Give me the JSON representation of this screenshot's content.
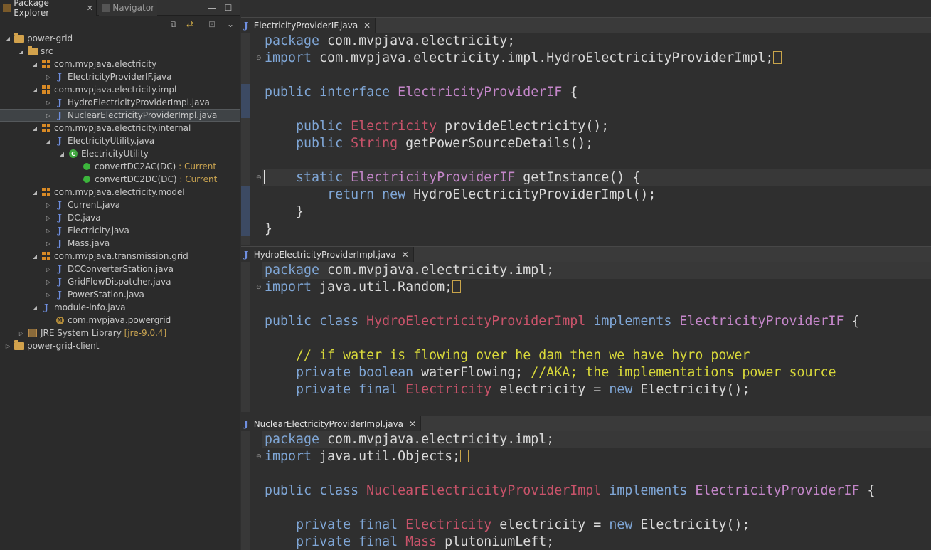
{
  "left_panel": {
    "tabs": [
      {
        "label": "Package Explorer",
        "active": true
      },
      {
        "label": "Navigator",
        "active": false
      }
    ],
    "tree": [
      {
        "label": "power-grid",
        "icon": "project-folder-icon",
        "level": 0,
        "expanded": true
      },
      {
        "label": "src",
        "icon": "source-folder-icon",
        "level": 1,
        "expanded": true
      },
      {
        "label": "com.mvpjava.electricity",
        "icon": "package-icon",
        "level": 2,
        "expanded": true
      },
      {
        "label": "ElectricityProviderIF.java",
        "icon": "java-interface-file-icon",
        "level": 3,
        "expanded": false
      },
      {
        "label": "com.mvpjava.electricity.impl",
        "icon": "package-icon",
        "level": 2,
        "expanded": true
      },
      {
        "label": "HydroElectricityProviderImpl.java",
        "icon": "java-file-icon",
        "level": 3,
        "expanded": false
      },
      {
        "label": "NuclearElectricityProviderImpl.java",
        "icon": "java-file-icon",
        "level": 3,
        "expanded": false,
        "selected": true
      },
      {
        "label": "com.mvpjava.electricity.internal",
        "icon": "package-icon",
        "level": 2,
        "expanded": true
      },
      {
        "label": "ElectricityUtility.java",
        "icon": "java-file-icon",
        "level": 3,
        "expanded": true
      },
      {
        "label": "ElectricityUtility",
        "icon": "class-icon",
        "level": 4,
        "expanded": true
      },
      {
        "label": "convertDC2AC(DC)",
        "suffix": " : Current",
        "icon": "public-method-icon",
        "level": 5
      },
      {
        "label": "convertDC2DC(DC)",
        "suffix": " : Current",
        "icon": "public-method-icon",
        "level": 5
      },
      {
        "label": "com.mvpjava.electricity.model",
        "icon": "package-icon",
        "level": 2,
        "expanded": true
      },
      {
        "label": "Current.java",
        "icon": "java-file-icon",
        "level": 3,
        "expanded": false
      },
      {
        "label": "DC.java",
        "icon": "java-file-icon",
        "level": 3,
        "expanded": false
      },
      {
        "label": "Electricity.java",
        "icon": "java-file-icon",
        "level": 3,
        "expanded": false
      },
      {
        "label": "Mass.java",
        "icon": "java-file-icon",
        "level": 3,
        "expanded": false
      },
      {
        "label": "com.mvpjava.transmission.grid",
        "icon": "package-icon",
        "level": 2,
        "expanded": true
      },
      {
        "label": "DCConverterStation.java",
        "icon": "java-file-icon",
        "level": 3,
        "expanded": false
      },
      {
        "label": "GridFlowDispatcher.java",
        "icon": "java-file-icon",
        "level": 3,
        "expanded": false
      },
      {
        "label": "PowerStation.java",
        "icon": "java-file-icon",
        "level": 3,
        "expanded": false
      },
      {
        "label": "module-info.java",
        "icon": "java-file-icon",
        "level": 2,
        "expanded": true
      },
      {
        "label": "com.mvpjava.powergrid",
        "icon": "module-icon",
        "level": 3
      },
      {
        "label": "JRE System Library",
        "suffix": " [jre-9.0.4]",
        "icon": "library-icon",
        "level": 1,
        "expanded": false
      },
      {
        "label": "power-grid-client",
        "icon": "project-folder-icon",
        "level": 0,
        "expanded": false
      }
    ]
  },
  "editors": [
    {
      "tab": "ElectricityProviderIF.java",
      "lines": [
        [
          [
            "k",
            "package"
          ],
          [
            "p",
            " com.mvpjava.electricity;"
          ]
        ],
        [
          [
            "k",
            "import"
          ],
          [
            "p",
            " com.mvpjava.electricity.impl.HydroElectricityProviderImpl;"
          ],
          [
            "box",
            ""
          ]
        ],
        [],
        [
          [
            "k",
            "public"
          ],
          [
            "p",
            " "
          ],
          [
            "k",
            "interface"
          ],
          [
            "p",
            " "
          ],
          [
            "t",
            "ElectricityProviderIF"
          ],
          [
            "p",
            " {"
          ]
        ],
        [],
        [
          [
            "p",
            "    "
          ],
          [
            "k",
            "public"
          ],
          [
            "p",
            " "
          ],
          [
            "c",
            "Electricity"
          ],
          [
            "p",
            " provideElectricity();"
          ]
        ],
        [
          [
            "p",
            "    "
          ],
          [
            "k",
            "public"
          ],
          [
            "p",
            " "
          ],
          [
            "c",
            "String"
          ],
          [
            "p",
            " getPowerSourceDetails();"
          ]
        ],
        [],
        [
          [
            "p",
            "    "
          ],
          [
            "k",
            "static"
          ],
          [
            "p",
            " "
          ],
          [
            "t",
            "ElectricityProviderIF"
          ],
          [
            "p",
            " getInstance() {"
          ]
        ],
        [
          [
            "p",
            "        "
          ],
          [
            "k",
            "return"
          ],
          [
            "p",
            " "
          ],
          [
            "k",
            "new"
          ],
          [
            "p",
            " HydroElectricityProviderImpl();"
          ]
        ],
        [
          [
            "p",
            "    }"
          ]
        ],
        [
          [
            "p",
            "}"
          ]
        ]
      ]
    },
    {
      "tab": "HydroElectricityProviderImpl.java",
      "lines": [
        [
          [
            "k",
            "package"
          ],
          [
            "p",
            " com.mvpjava.electricity.impl;"
          ]
        ],
        [
          [
            "k",
            "import"
          ],
          [
            "p",
            " java.util.Random;"
          ],
          [
            "box",
            ""
          ]
        ],
        [],
        [
          [
            "k",
            "public"
          ],
          [
            "p",
            " "
          ],
          [
            "k",
            "class"
          ],
          [
            "p",
            " "
          ],
          [
            "c",
            "HydroElectricityProviderImpl"
          ],
          [
            "p",
            " "
          ],
          [
            "k",
            "implements"
          ],
          [
            "p",
            " "
          ],
          [
            "t",
            "ElectricityProviderIF"
          ],
          [
            "p",
            " {"
          ]
        ],
        [],
        [
          [
            "p",
            "    "
          ],
          [
            "cm",
            "// if water is flowing over he dam then we have hyro power"
          ]
        ],
        [
          [
            "p",
            "    "
          ],
          [
            "k",
            "private"
          ],
          [
            "p",
            " "
          ],
          [
            "k",
            "boolean"
          ],
          [
            "p",
            " waterFlowing; "
          ],
          [
            "cm",
            "//AKA; the implementations power source"
          ]
        ],
        [
          [
            "p",
            "    "
          ],
          [
            "k",
            "private"
          ],
          [
            "p",
            " "
          ],
          [
            "k",
            "final"
          ],
          [
            "p",
            " "
          ],
          [
            "c",
            "Electricity"
          ],
          [
            "p",
            " electricity = "
          ],
          [
            "k",
            "new"
          ],
          [
            "p",
            " Electricity();"
          ]
        ]
      ]
    },
    {
      "tab": "NuclearElectricityProviderImpl.java",
      "lines": [
        [
          [
            "k",
            "package"
          ],
          [
            "p",
            " com.mvpjava.electricity.impl;"
          ]
        ],
        [
          [
            "k",
            "import"
          ],
          [
            "p",
            " java.util.Objects;"
          ],
          [
            "box",
            ""
          ]
        ],
        [],
        [
          [
            "k",
            "public"
          ],
          [
            "p",
            " "
          ],
          [
            "k",
            "class"
          ],
          [
            "p",
            " "
          ],
          [
            "c",
            "NuclearElectricityProviderImpl"
          ],
          [
            "p",
            " "
          ],
          [
            "k",
            "implements"
          ],
          [
            "p",
            " "
          ],
          [
            "t",
            "ElectricityProviderIF"
          ],
          [
            "p",
            " {"
          ]
        ],
        [],
        [
          [
            "p",
            "    "
          ],
          [
            "k",
            "private"
          ],
          [
            "p",
            " "
          ],
          [
            "k",
            "final"
          ],
          [
            "p",
            " "
          ],
          [
            "c",
            "Electricity"
          ],
          [
            "p",
            " electricity = "
          ],
          [
            "k",
            "new"
          ],
          [
            "p",
            " Electricity();"
          ]
        ],
        [
          [
            "p",
            "    "
          ],
          [
            "k",
            "private"
          ],
          [
            "p",
            " "
          ],
          [
            "k",
            "final"
          ],
          [
            "p",
            " "
          ],
          [
            "c",
            "Mass"
          ],
          [
            "p",
            " plutoniumLeft;"
          ]
        ]
      ]
    }
  ]
}
